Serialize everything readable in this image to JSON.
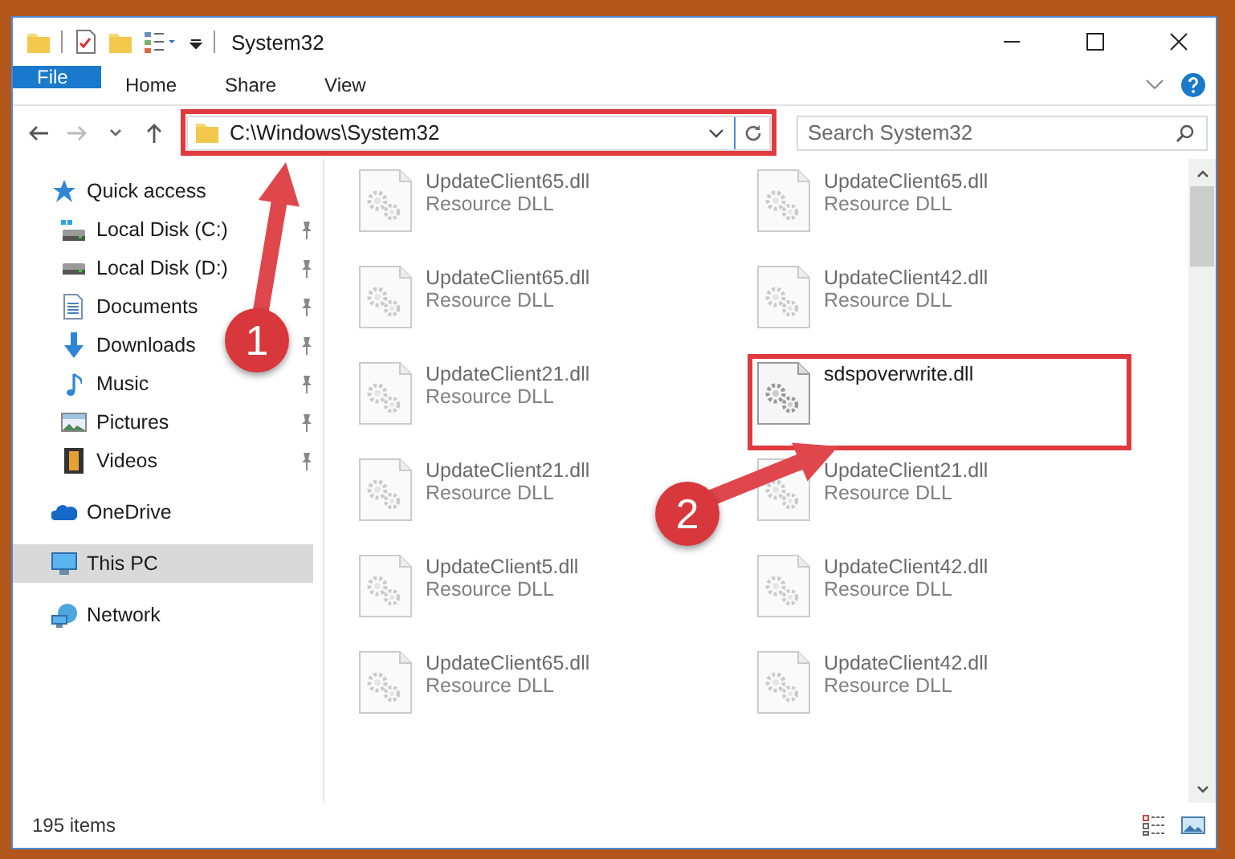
{
  "window": {
    "title": "System32"
  },
  "ribbon_tabs": [
    {
      "label": "File",
      "kind": "file",
      "selected": false
    },
    {
      "label": "Home",
      "kind": "tab",
      "selected": false
    },
    {
      "label": "Share",
      "kind": "tab",
      "selected": false
    },
    {
      "label": "View",
      "kind": "tab",
      "selected": false
    }
  ],
  "address_bar": {
    "value": "C:\\Windows\\System32"
  },
  "search": {
    "placeholder": "Search System32"
  },
  "navigation": [
    {
      "label": "Quick access",
      "selected": false,
      "pinned": false,
      "children": [
        {
          "label": "Local Disk (C:)",
          "selected": false,
          "pinned": true
        },
        {
          "label": "Local Disk (D:)",
          "selected": false,
          "pinned": true
        },
        {
          "label": "Documents",
          "selected": false,
          "pinned": true
        },
        {
          "label": "Downloads",
          "selected": false,
          "pinned": true
        },
        {
          "label": "Music",
          "selected": false,
          "pinned": true
        },
        {
          "label": "Pictures",
          "selected": false,
          "pinned": true
        },
        {
          "label": "Videos",
          "selected": false,
          "pinned": true
        }
      ]
    },
    {
      "label": "OneDrive",
      "selected": false,
      "pinned": false
    },
    {
      "label": "This PC",
      "selected": true,
      "pinned": false
    },
    {
      "label": "Network",
      "selected": false,
      "pinned": false
    }
  ],
  "files": [
    {
      "name": "UpdateClient65.dll",
      "type": "Resource DLL",
      "blurred": true
    },
    {
      "name": "UpdateClient65.dll",
      "type": "Resource DLL",
      "blurred": true
    },
    {
      "name": "UpdateClient65.dll",
      "type": "Resource DLL",
      "blurred": true
    },
    {
      "name": "UpdateClient42.dll",
      "type": "Resource DLL",
      "blurred": true
    },
    {
      "name": "UpdateClient21.dll",
      "type": "Resource DLL",
      "blurred": true
    },
    {
      "name": "sdspoverwrite.dll",
      "blurred": false
    },
    {
      "name": "UpdateClient21.dll",
      "type": "Resource DLL",
      "blurred": true
    },
    {
      "name": "UpdateClient21.dll",
      "type": "Resource DLL",
      "blurred": true
    },
    {
      "name": "UpdateClient5.dll",
      "type": "Resource DLL",
      "blurred": true
    },
    {
      "name": "UpdateClient42.dll",
      "type": "Resource DLL",
      "blurred": true
    },
    {
      "name": "UpdateClient65.dll",
      "type": "Resource DLL",
      "blurred": true
    },
    {
      "name": "UpdateClient42.dll",
      "type": "Resource DLL",
      "blurred": true
    }
  ],
  "status_bar": {
    "item_count": "195 items"
  },
  "callouts": [
    {
      "number": "1"
    },
    {
      "number": "2"
    }
  ]
}
